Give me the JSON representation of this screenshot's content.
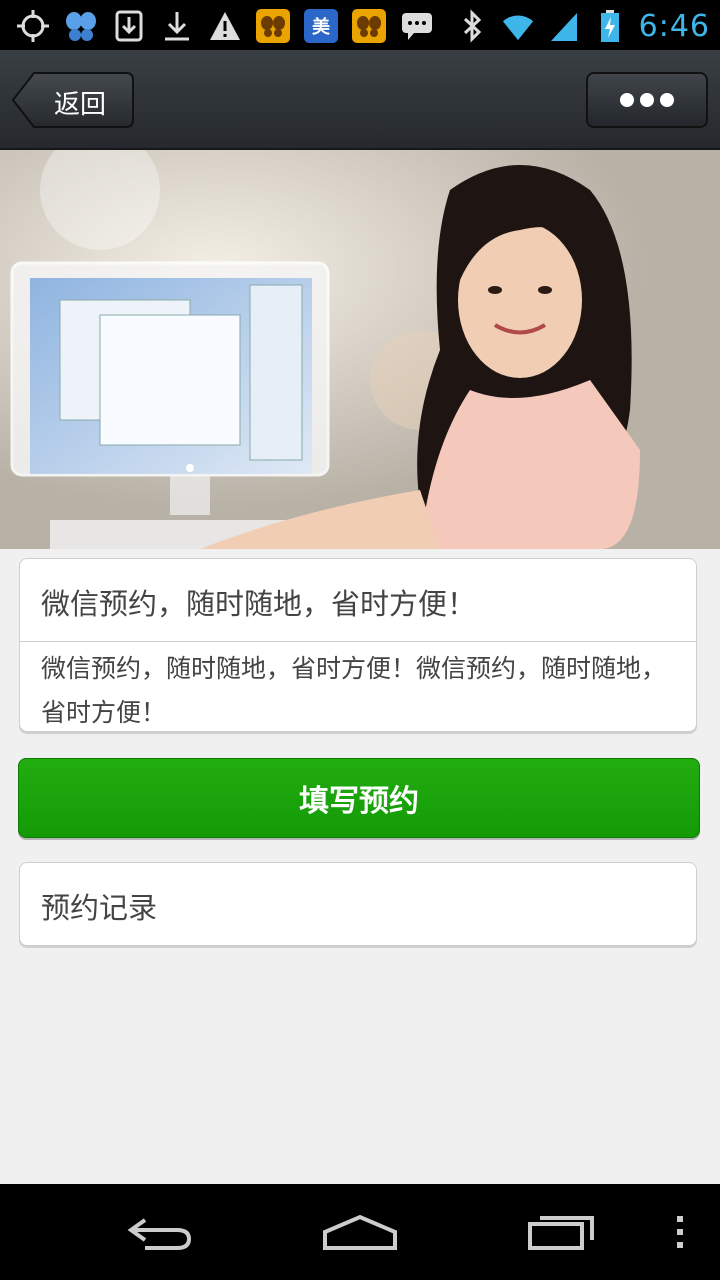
{
  "status_bar": {
    "time": "6:46",
    "app_icon_mei": "美",
    "icons": [
      "gps-icon",
      "butterfly-icon",
      "download-box-icon",
      "download-icon",
      "warning-icon",
      "butterfly-app-icon",
      "mei-app-icon",
      "butterfly-app-icon",
      "chat-icon",
      "bluetooth-icon",
      "wifi-icon",
      "signal-icon",
      "battery-charging-icon"
    ]
  },
  "header": {
    "back_label": "返回",
    "more_icon": "more-dots-icon"
  },
  "banner": {
    "description": "image-woman-at-computer"
  },
  "info": {
    "title": "微信预约，随时随地，省时方便！",
    "description": "微信预约，随时随地，省时方便！微信预约，随时随地，省时方便！"
  },
  "actions": {
    "fill_label": "填写预约",
    "records_label": "预约记录"
  },
  "colors": {
    "primary_green": "#18a309",
    "header_dark": "#2c3035",
    "time_blue": "#3fb6ea"
  },
  "nav": {
    "icons": [
      "back-nav-icon",
      "home-nav-icon",
      "recent-apps-icon",
      "overflow-menu-icon"
    ]
  }
}
